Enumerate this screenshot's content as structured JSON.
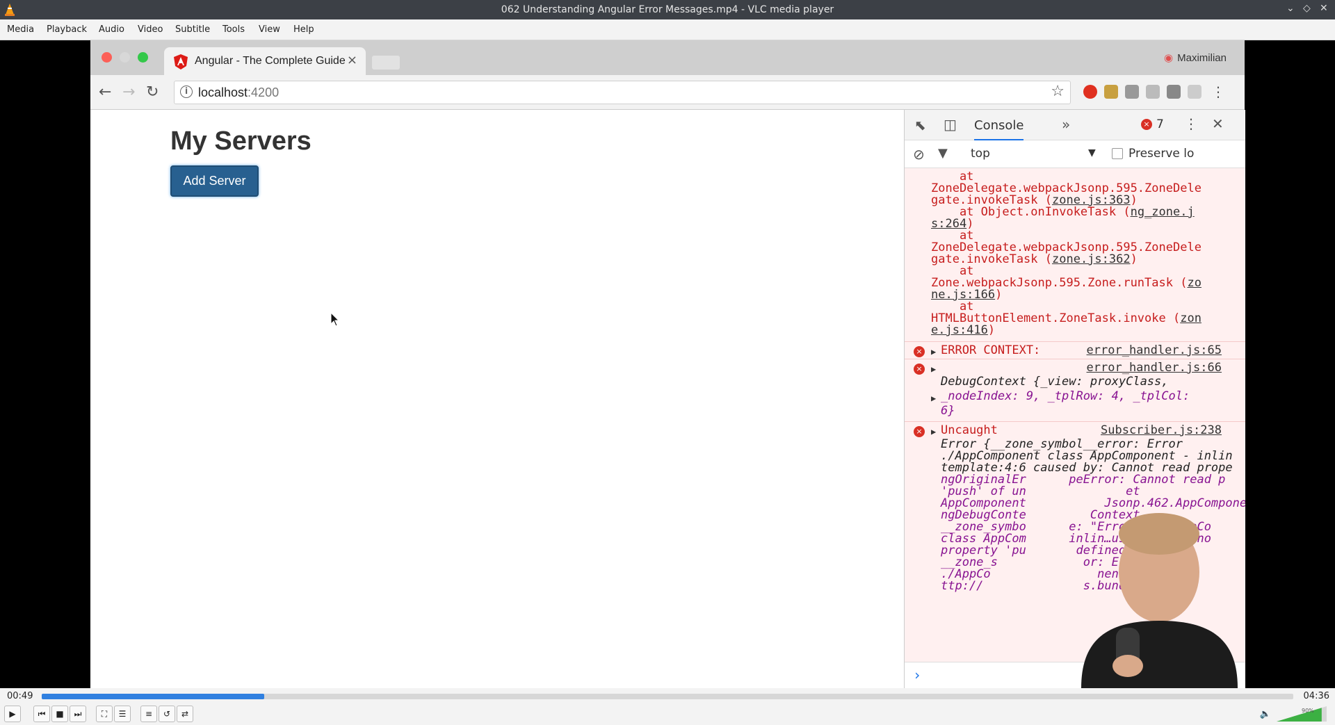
{
  "window": {
    "title": "062 Understanding Angular Error Messages.mp4 - VLC media player"
  },
  "menu": [
    "Media",
    "Playback",
    "Audio",
    "Video",
    "Subtitle",
    "Tools",
    "View",
    "Help"
  ],
  "browser": {
    "tab_title": "Angular - The Complete Guide",
    "profile_name": "Maximilian",
    "url_host": "localhost",
    "url_port": ":4200"
  },
  "page": {
    "heading": "My Servers",
    "add_button": "Add Server"
  },
  "devtools": {
    "tab_label": "Console",
    "error_count": "7",
    "context": "top",
    "preserve_log": "Preserve lo",
    "stack": [
      {
        "text": "    at",
        "link": ""
      },
      {
        "text": "ZoneDelegate.webpackJsonp.595.ZoneDele",
        "link": ""
      },
      {
        "text": "gate.invokeTask (",
        "link": "zone.js:363",
        "tail": ")"
      },
      {
        "text": "    at Object.onInvokeTask (",
        "link": "ng_zone.j",
        "tail": ""
      },
      {
        "text": "",
        "link": "s:264",
        "tail": ")"
      },
      {
        "text": "    at",
        "link": ""
      },
      {
        "text": "ZoneDelegate.webpackJsonp.595.ZoneDele",
        "link": ""
      },
      {
        "text": "gate.invokeTask (",
        "link": "zone.js:362",
        "tail": ")"
      },
      {
        "text": "    at",
        "link": ""
      },
      {
        "text": "Zone.webpackJsonp.595.Zone.runTask (",
        "link": "zo",
        "tail": ""
      },
      {
        "text": "",
        "link": "ne.js:166",
        "tail": ")"
      },
      {
        "text": "    at",
        "link": ""
      },
      {
        "text": "HTMLButtonElement.ZoneTask.invoke (",
        "link": "zon",
        "tail": ""
      },
      {
        "text": "",
        "link": "e.js:416",
        "tail": ")"
      }
    ],
    "error_context_label": "ERROR CONTEXT:",
    "error_context_src": "error_handler.js:65",
    "debug_src": "error_handler.js:66",
    "debug_line1": "DebugContext {_view: proxyClass,",
    "debug_line2": "_nodeIndex: 9, _tplRow: 4, _tplCol:",
    "debug_line3": "6}",
    "uncaught_label": "Uncaught",
    "uncaught_src": "Subscriber.js:238",
    "uncaught_lines": [
      "Error {__zone_symbol__error: Error",
      "./AppComponent class AppComponent - inlin",
      "template:4:6 caused by: Cannot read prope",
      "ngOriginalEr      peError: Cannot read p",
      "'push' of un              et",
      "AppComponent           Jsonp.462.AppComponen",
      "ngDebugConte         Context,",
      "__zone_symbo      e: \"Error in ./AppCo",
      "class AppCom      inlin…used by: Canno",
      "property 'pu       defined\",",
      "__zone_s            or: Error in",
      "./AppCo               nent …",
      "ttp://              s.bundle.js:"
    ]
  },
  "player": {
    "elapsed": "00:49",
    "total": "04:36",
    "progress": 0.178,
    "volume_label": "90%",
    "volume": 0.9
  },
  "colors": {
    "accent": "#3080e0",
    "error": "#c61d1d",
    "button": "#286090"
  }
}
